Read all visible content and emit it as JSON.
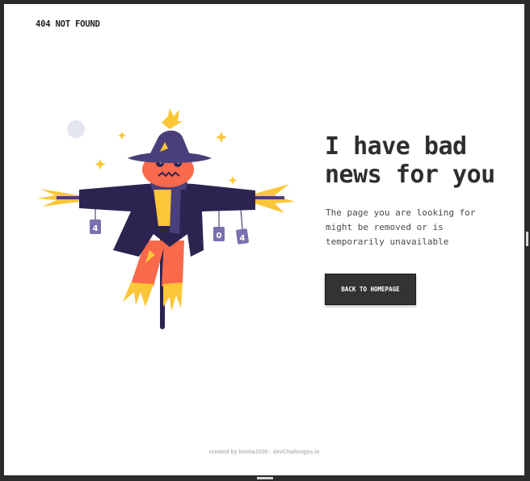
{
  "header": {
    "logo_text": "404 NOT FOUND"
  },
  "main": {
    "headline": "I have bad news for you",
    "description": "The page you are looking for might be removed or is temporarily unavailable",
    "cta_label": "BACK TO HOMEPAGE"
  },
  "illustration": {
    "can_labels": [
      "4",
      "0",
      "4"
    ]
  },
  "footer": {
    "credit": "created by kimha1030 - devChallenges.io"
  },
  "colors": {
    "background": "#ffffff",
    "text_dark": "#2e2e2e",
    "button": "#333333",
    "scarecrow_coat": "#2b2451",
    "scarecrow_hat": "#4a3f7a",
    "scarecrow_face": "#f86a4b",
    "straw": "#fbc638"
  }
}
